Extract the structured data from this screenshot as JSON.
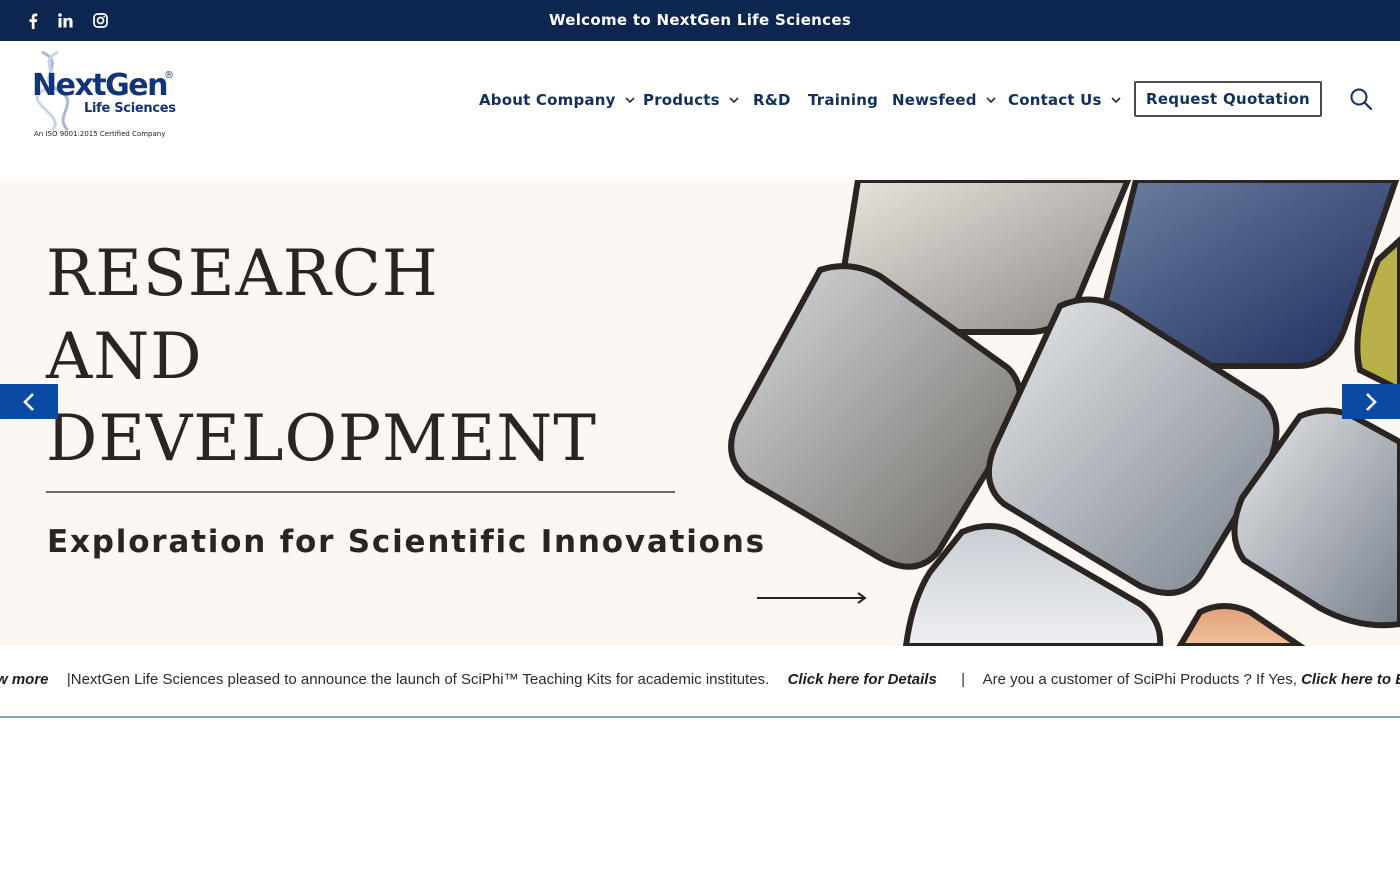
{
  "topbar": {
    "welcome_text": "Welcome to NextGen Life Sciences",
    "social": [
      "facebook-icon",
      "linkedin-icon",
      "instagram-icon"
    ],
    "bg_color": "#0c2650"
  },
  "logo": {
    "main": "NextGen",
    "reg": "®",
    "sub": "Life Sciences",
    "iso": "An ISO 9001:2015 Certified Company"
  },
  "nav": {
    "items": [
      {
        "label": "About Company",
        "has_dropdown": true
      },
      {
        "label": "Products",
        "has_dropdown": true
      },
      {
        "label": "R&D",
        "has_dropdown": false
      },
      {
        "label": "Training",
        "has_dropdown": false
      },
      {
        "label": "Newsfeed",
        "has_dropdown": true
      },
      {
        "label": "Contact Us",
        "has_dropdown": true
      }
    ],
    "quote_button": "Request Quotation",
    "search_icon": "search-icon"
  },
  "hero": {
    "title_lines": [
      "RESEARCH",
      "AND",
      "DEVELOPMENT"
    ],
    "subtitle": "Exploration for Scientific Innovations",
    "prev_icon": "chevron-left-icon",
    "next_icon": "chevron-right-icon"
  },
  "ticker": {
    "seg1_link": "w more",
    "seg2_text": "|NextGen Life Sciences pleased to announce the launch of SciPhi™  Teaching Kits for academic institutes.",
    "seg2_link": "Click here for Details",
    "separator": "|",
    "seg3_text": "Are you a customer of SciPhi Products ? If Yes,",
    "seg3_link": "Click here to Enroll"
  }
}
